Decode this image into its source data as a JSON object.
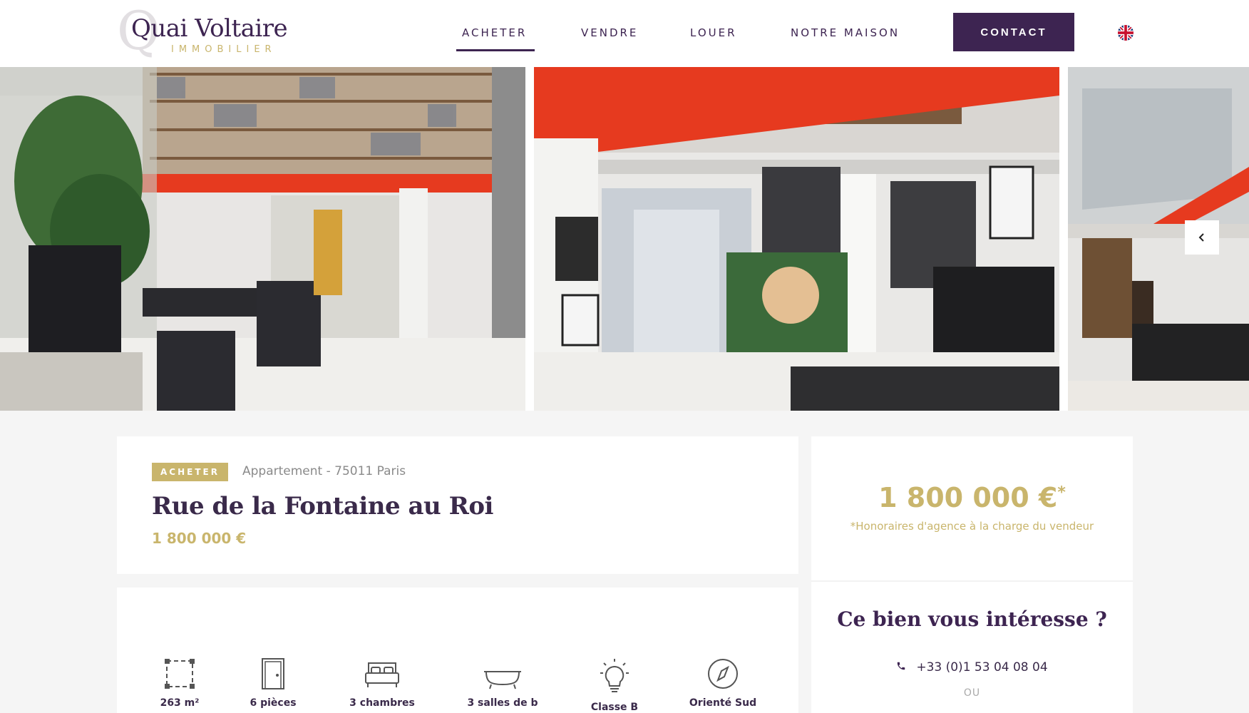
{
  "brand": {
    "q_letter": "Q",
    "name": "Quai Voltaire",
    "tagline": "IMMOBILIER"
  },
  "nav": {
    "items": [
      {
        "label": "ACHETER",
        "active": true
      },
      {
        "label": "VENDRE"
      },
      {
        "label": "LOUER"
      },
      {
        "label": "NOTRE MAISON"
      }
    ],
    "contact_label": "CONTACT",
    "language_icon": "uk-flag-icon"
  },
  "gallery": {
    "prev_icon": "chevron-left-icon",
    "photo_count_visible": 3
  },
  "listing": {
    "tag": "ACHETER",
    "subtitle": "Appartement - 75011 Paris",
    "title": "Rue de la Fontaine au Roi",
    "price": "1 800 000 €"
  },
  "price_box": {
    "price": "1 800 000 €",
    "asterisk": "*",
    "note": "*Honoraires d'agence à la charge du vendeur"
  },
  "contact_box": {
    "heading": "Ce bien vous intéresse ?",
    "phone": "+33 (0)1 53 04 08 04",
    "or": "OU"
  },
  "features": [
    {
      "icon": "surface-icon",
      "label": "263 m²"
    },
    {
      "icon": "door-icon",
      "label": "6 pièces"
    },
    {
      "icon": "bed-icon",
      "label": "3 chambres"
    },
    {
      "icon": "bathtub-icon",
      "label": "3 salles de b"
    },
    {
      "icon": "lightbulb-icon",
      "label": "Classe B"
    },
    {
      "icon": "compass-icon",
      "label": "Orienté Sud"
    }
  ],
  "colors": {
    "primary": "#3d2451",
    "gold": "#c9b56c",
    "background": "#f5f5f5"
  }
}
